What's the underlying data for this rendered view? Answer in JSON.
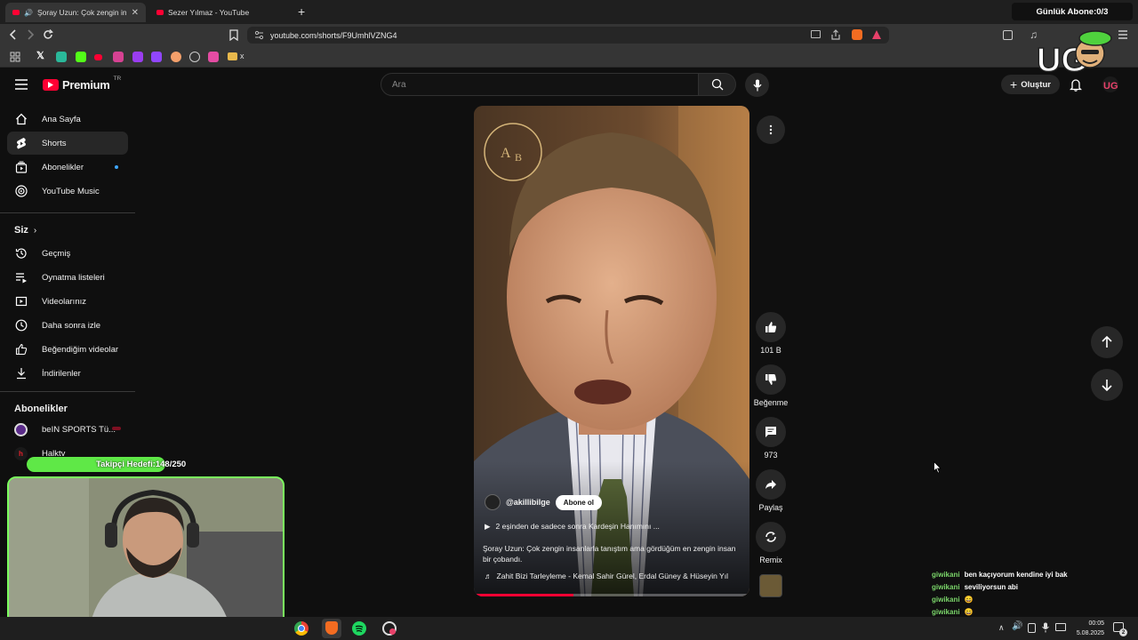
{
  "browser": {
    "tabs": [
      {
        "title": "Şoray Uzun: Çok zengin insan",
        "active": true
      },
      {
        "title": "Sezer Yılmaz - YouTube",
        "active": false
      }
    ],
    "new_tab_icon": "plus-icon",
    "url": "youtube.com/shorts/F9UmhlVZNG4",
    "bookmark_folder_label": "x"
  },
  "stream_overlay": {
    "abone_goal": "Günlük Abone:0/3",
    "follow_goal": "Takipçi Hedefi:148/250",
    "chat": [
      {
        "user": "giwikani",
        "message": "ben kaçıyorum kendine iyi bak"
      },
      {
        "user": "giwikani",
        "message": "seviliyorsun abi"
      },
      {
        "user": "giwikani",
        "message": "😄"
      },
      {
        "user": "giwikani",
        "message": "😄"
      },
      {
        "user": "giwikani",
        "message": "😄"
      }
    ]
  },
  "youtube": {
    "logo_text": "Premium",
    "logo_superscript": "TR",
    "search_placeholder": "Ara",
    "create_label": "Oluştur",
    "sidebar": {
      "main": [
        {
          "label": "Ana Sayfa",
          "icon": "home-icon"
        },
        {
          "label": "Shorts",
          "icon": "shorts-icon"
        },
        {
          "label": "Abonelikler",
          "icon": "subscriptions-icon"
        },
        {
          "label": "YouTube Music",
          "icon": "music-icon"
        }
      ],
      "you_title": "Siz",
      "you": [
        {
          "label": "Geçmiş",
          "icon": "history-icon"
        },
        {
          "label": "Oynatma listeleri",
          "icon": "playlists-icon"
        },
        {
          "label": "Videolarınız",
          "icon": "your-videos-icon"
        },
        {
          "label": "Daha sonra izle",
          "icon": "watch-later-icon"
        },
        {
          "label": "Beğendiğim videolar",
          "icon": "liked-icon"
        },
        {
          "label": "İndirilenler",
          "icon": "download-icon"
        }
      ],
      "subs_title": "Abonelikler",
      "subs": [
        {
          "label": "beIN SPORTS Tü..."
        },
        {
          "label": "Halktv"
        }
      ]
    },
    "short": {
      "channel": "@akillibilge",
      "subscribe_label": "Abone ol",
      "playlist_text": "2 eşinden de sadece sonra Kardeşin Hanımını ...",
      "title": "Şoray Uzun: Çok zengin insanlarla tanıştım ama gördüğüm en zengin insan bir çobandı.",
      "music": "Zahit Bizi Tarleyleme - Kemal Sahir Gürel, Erdal Güney & Hüseyin Yıl",
      "progress": 0.36,
      "actions": {
        "like_count": "101 B",
        "dislike_label": "Beğenme",
        "comment_count": "973",
        "share_label": "Paylaş",
        "remix_label": "Remix"
      }
    }
  },
  "taskbar": {
    "time": "00:05",
    "date": "5.08.2025",
    "notification_count": "2"
  }
}
